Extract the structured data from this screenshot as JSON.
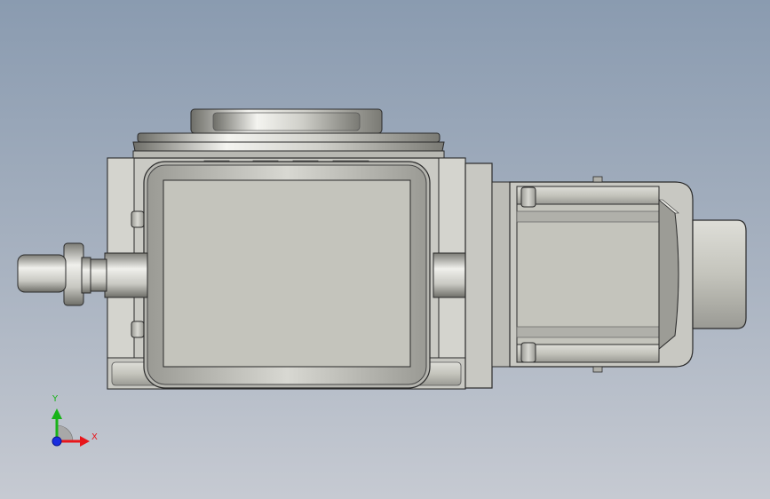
{
  "viewport": {
    "background_top": "#8a9bb0",
    "background_bottom": "#c6cad2"
  },
  "model": {
    "body_color": "#c4c4bc",
    "edge_color": "#2a2a2a",
    "highlight_color": "#f2f2ee",
    "shadow_color": "#8c8c86"
  },
  "triad": {
    "x_label": "X",
    "y_label": "Y",
    "x_color": "#e8161b",
    "y_color": "#18b318",
    "z_color": "#1a2ee0"
  }
}
